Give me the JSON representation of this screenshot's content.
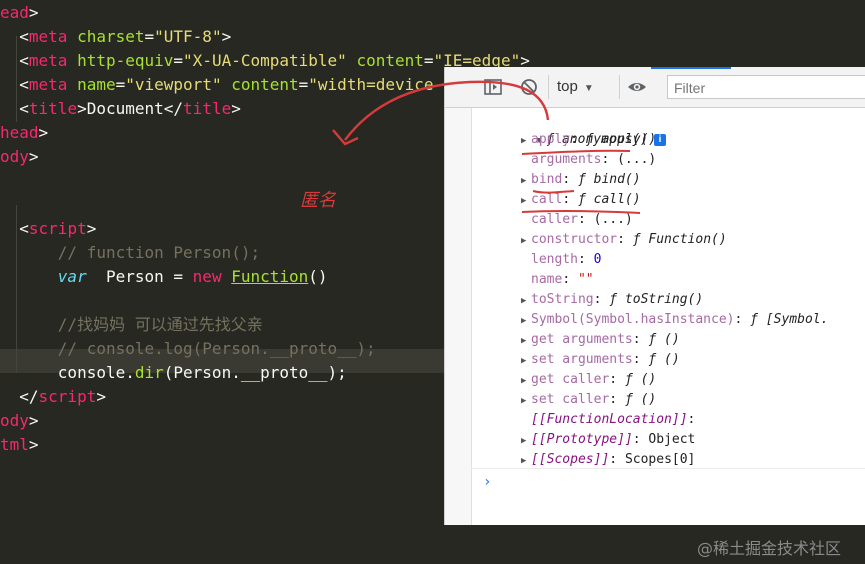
{
  "editor": {
    "lines": [
      {
        "segments": [
          {
            "c": "t-tag",
            "t": "ead"
          },
          {
            "c": "t-txt",
            "t": ">"
          }
        ]
      },
      {
        "segments": [
          {
            "c": "t-txt",
            "t": "  <"
          },
          {
            "c": "t-tag",
            "t": "meta"
          },
          {
            "c": "t-attr",
            "t": " charset"
          },
          {
            "c": "t-txt",
            "t": "="
          },
          {
            "c": "t-str",
            "t": "\"UTF-8\""
          },
          {
            "c": "t-txt",
            "t": ">"
          }
        ]
      },
      {
        "segments": [
          {
            "c": "t-txt",
            "t": "  <"
          },
          {
            "c": "t-tag",
            "t": "meta"
          },
          {
            "c": "t-attr",
            "t": " http-equiv"
          },
          {
            "c": "t-txt",
            "t": "="
          },
          {
            "c": "t-str",
            "t": "\"X-UA-Compatible\""
          },
          {
            "c": "t-attr",
            "t": " content"
          },
          {
            "c": "t-txt",
            "t": "="
          },
          {
            "c": "t-str",
            "t": "\"IE=edge\""
          },
          {
            "c": "t-txt",
            "t": ">"
          }
        ]
      },
      {
        "segments": [
          {
            "c": "t-txt",
            "t": "  <"
          },
          {
            "c": "t-tag",
            "t": "meta"
          },
          {
            "c": "t-attr",
            "t": " name"
          },
          {
            "c": "t-txt",
            "t": "="
          },
          {
            "c": "t-str",
            "t": "\"viewport\""
          },
          {
            "c": "t-attr",
            "t": " content"
          },
          {
            "c": "t-txt",
            "t": "="
          },
          {
            "c": "t-str",
            "t": "\"width=device-"
          }
        ]
      },
      {
        "segments": [
          {
            "c": "t-txt",
            "t": "  <"
          },
          {
            "c": "t-tag",
            "t": "title"
          },
          {
            "c": "t-txt",
            "t": ">Document</"
          },
          {
            "c": "t-tag",
            "t": "title"
          },
          {
            "c": "t-txt",
            "t": ">"
          }
        ]
      },
      {
        "segments": [
          {
            "c": "t-tag",
            "t": "head"
          },
          {
            "c": "t-txt",
            "t": ">"
          }
        ]
      },
      {
        "segments": [
          {
            "c": "t-tag",
            "t": "ody"
          },
          {
            "c": "t-txt",
            "t": ">"
          }
        ]
      },
      {
        "segments": []
      },
      {
        "segments": []
      },
      {
        "segments": [
          {
            "c": "t-txt",
            "t": "  <"
          },
          {
            "c": "t-tag",
            "t": "script"
          },
          {
            "c": "t-txt",
            "t": ">"
          }
        ]
      },
      {
        "segments": [
          {
            "c": "t-cmt",
            "t": "      // function Person();"
          }
        ]
      },
      {
        "segments": [
          {
            "c": "t-txt",
            "t": "      "
          },
          {
            "c": "t-kw",
            "t": "var"
          },
          {
            "c": "t-txt",
            "t": "  Person = "
          },
          {
            "c": "t-new",
            "t": "new"
          },
          {
            "c": "t-txt",
            "t": " "
          },
          {
            "c": "t-fn",
            "t": "Function"
          },
          {
            "c": "t-txt",
            "t": "()"
          }
        ]
      },
      {
        "segments": []
      },
      {
        "segments": [
          {
            "c": "t-cmt",
            "t": "      //找妈妈 可以通过先找父亲"
          }
        ]
      },
      {
        "segments": [
          {
            "c": "t-cmt",
            "t": "      // console.log(Person.__proto__);"
          }
        ]
      },
      {
        "segments": [
          {
            "c": "t-txt",
            "t": "      console."
          },
          {
            "c": "t-fnc",
            "t": "dir"
          },
          {
            "c": "t-txt",
            "t": "(Person.__proto__);"
          }
        ]
      },
      {
        "segments": [
          {
            "c": "t-txt",
            "t": "  </"
          },
          {
            "c": "t-tag",
            "t": "script"
          },
          {
            "c": "t-txt",
            "t": ">"
          }
        ]
      },
      {
        "segments": [
          {
            "c": "t-tag",
            "t": "ody"
          },
          {
            "c": "t-txt",
            "t": ">"
          }
        ]
      },
      {
        "segments": [
          {
            "c": "t-tag",
            "t": "tml"
          },
          {
            "c": "t-txt",
            "t": ">"
          }
        ]
      }
    ],
    "annotation_text": "匿名"
  },
  "devtools": {
    "toolbar": {
      "context": "top",
      "filter_placeholder": "Filter"
    },
    "object": {
      "header_prefix": "ƒ",
      "header_name": "anonymous()",
      "info_badge": "i",
      "props": [
        {
          "expand": true,
          "key": "apply",
          "key_style": "k-dim",
          "sep": ": ",
          "value": "ƒ apply()",
          "value_style": "v"
        },
        {
          "expand": false,
          "key": "arguments",
          "key_style": "k-dim",
          "sep": ": ",
          "value": "(...)",
          "value_style": "v-plain"
        },
        {
          "expand": true,
          "key": "bind",
          "key_style": "k-dim",
          "sep": ": ",
          "value": "ƒ bind()",
          "value_style": "v"
        },
        {
          "expand": true,
          "key": "call",
          "key_style": "k-dim",
          "sep": ": ",
          "value": "ƒ call()",
          "value_style": "v"
        },
        {
          "expand": false,
          "key": "caller",
          "key_style": "k-dim",
          "sep": ": ",
          "value": "(...)",
          "value_style": "v-plain"
        },
        {
          "expand": true,
          "key": "constructor",
          "key_style": "k-dim",
          "sep": ": ",
          "value": "ƒ Function()",
          "value_style": "v"
        },
        {
          "expand": false,
          "key": "length",
          "key_style": "k-dim",
          "sep": ": ",
          "value": "0",
          "value_style": "v-num"
        },
        {
          "expand": false,
          "key": "name",
          "key_style": "k-dim",
          "sep": ": ",
          "value": "\"\"",
          "value_style": "v-str"
        },
        {
          "expand": true,
          "key": "toString",
          "key_style": "k-dim",
          "sep": ": ",
          "value": "ƒ toString()",
          "value_style": "v"
        },
        {
          "expand": true,
          "key": "Symbol(Symbol.hasInstance)",
          "key_style": "k-dim",
          "sep": ": ",
          "value": "ƒ [Symbol.",
          "value_style": "v"
        },
        {
          "expand": true,
          "key": "get arguments",
          "key_style": "k-dim",
          "sep": ": ",
          "value": "ƒ ()",
          "value_style": "v"
        },
        {
          "expand": true,
          "key": "set arguments",
          "key_style": "k-dim",
          "sep": ": ",
          "value": "ƒ ()",
          "value_style": "v"
        },
        {
          "expand": true,
          "key": "get caller",
          "key_style": "k-dim",
          "sep": ": ",
          "value": "ƒ ()",
          "value_style": "v"
        },
        {
          "expand": true,
          "key": "set caller",
          "key_style": "k-dim",
          "sep": ": ",
          "value": "ƒ ()",
          "value_style": "v"
        },
        {
          "expand": false,
          "key": "[[FunctionLocation]]",
          "key_style": "k-italic",
          "sep": ":",
          "value": "",
          "value_style": "v-plain"
        },
        {
          "expand": true,
          "key": "[[Prototype]]",
          "key_style": "k-italic",
          "sep": ": ",
          "value": "Object",
          "value_style": "v-plain"
        },
        {
          "expand": true,
          "key": "[[Scopes]]",
          "key_style": "k-italic",
          "sep": ": ",
          "value": "Scopes[0]",
          "value_style": "v-plain"
        }
      ]
    },
    "prompt": "›"
  },
  "watermark": "@稀土掘金技术社区",
  "colors": {
    "editor_bg": "#272822",
    "annotation_red": "#d63a3a",
    "devtools_accent": "#1a73e8"
  }
}
